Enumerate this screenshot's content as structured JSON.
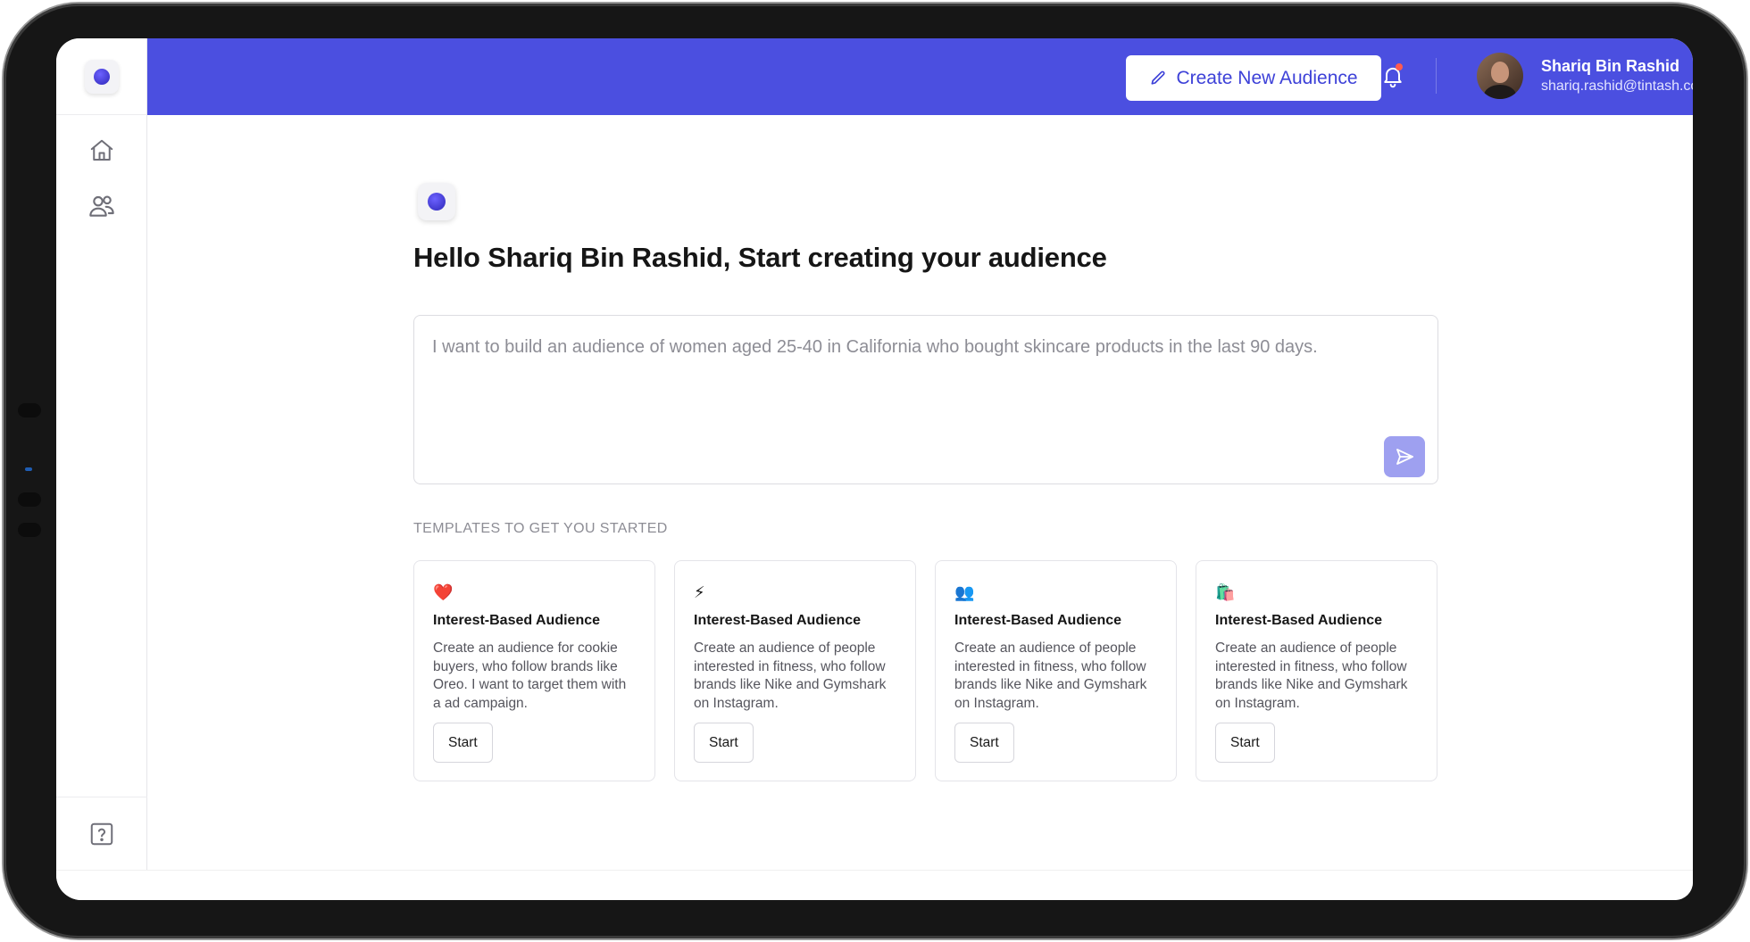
{
  "header": {
    "create_button_label": "Create New Audience",
    "user": {
      "name": "Shariq Bin Rashid",
      "email": "shariq.rashid@tintash.com"
    }
  },
  "sidebar": {
    "items": [
      {
        "name": "home",
        "icon": "home-icon"
      },
      {
        "name": "audiences",
        "icon": "users-icon"
      }
    ],
    "help_icon": "help-icon"
  },
  "main": {
    "title": "Hello Shariq Bin Rashid, Start creating your audience",
    "prompt": {
      "placeholder": "I want to build an audience of women aged 25-40 in California who bought skincare products in the last 90 days.",
      "value": ""
    },
    "templates_label": "TEMPLATES TO GET YOU STARTED",
    "templates": [
      {
        "emoji": "❤️",
        "icon": "heart-icon",
        "title": "Interest-Based Audience",
        "description": "Create an audience for cookie buyers, who follow brands like Oreo. I want to target them with a ad campaign.",
        "button_label": "Start"
      },
      {
        "emoji": "⚡",
        "icon": "lightning-icon",
        "title": "Interest-Based Audience",
        "description": "Create an audience of people interested in fitness, who follow brands like Nike and Gymshark on Instagram.",
        "button_label": "Start"
      },
      {
        "emoji": "👥",
        "icon": "people-icon",
        "title": "Interest-Based Audience",
        "description": "Create an audience of people interested in fitness, who follow brands like Nike and Gymshark on Instagram.",
        "button_label": "Start"
      },
      {
        "emoji": "🛍️",
        "icon": "shopping-bag-icon",
        "title": "Interest-Based Audience",
        "description": "Create an audience of people interested in fitness, who follow brands like Nike and Gymshark on Instagram.",
        "button_label": "Start"
      }
    ]
  },
  "colors": {
    "brand": "#4b4fe0",
    "send_button": "#9ea0f0",
    "notification_dot": "#ff5a4f"
  }
}
